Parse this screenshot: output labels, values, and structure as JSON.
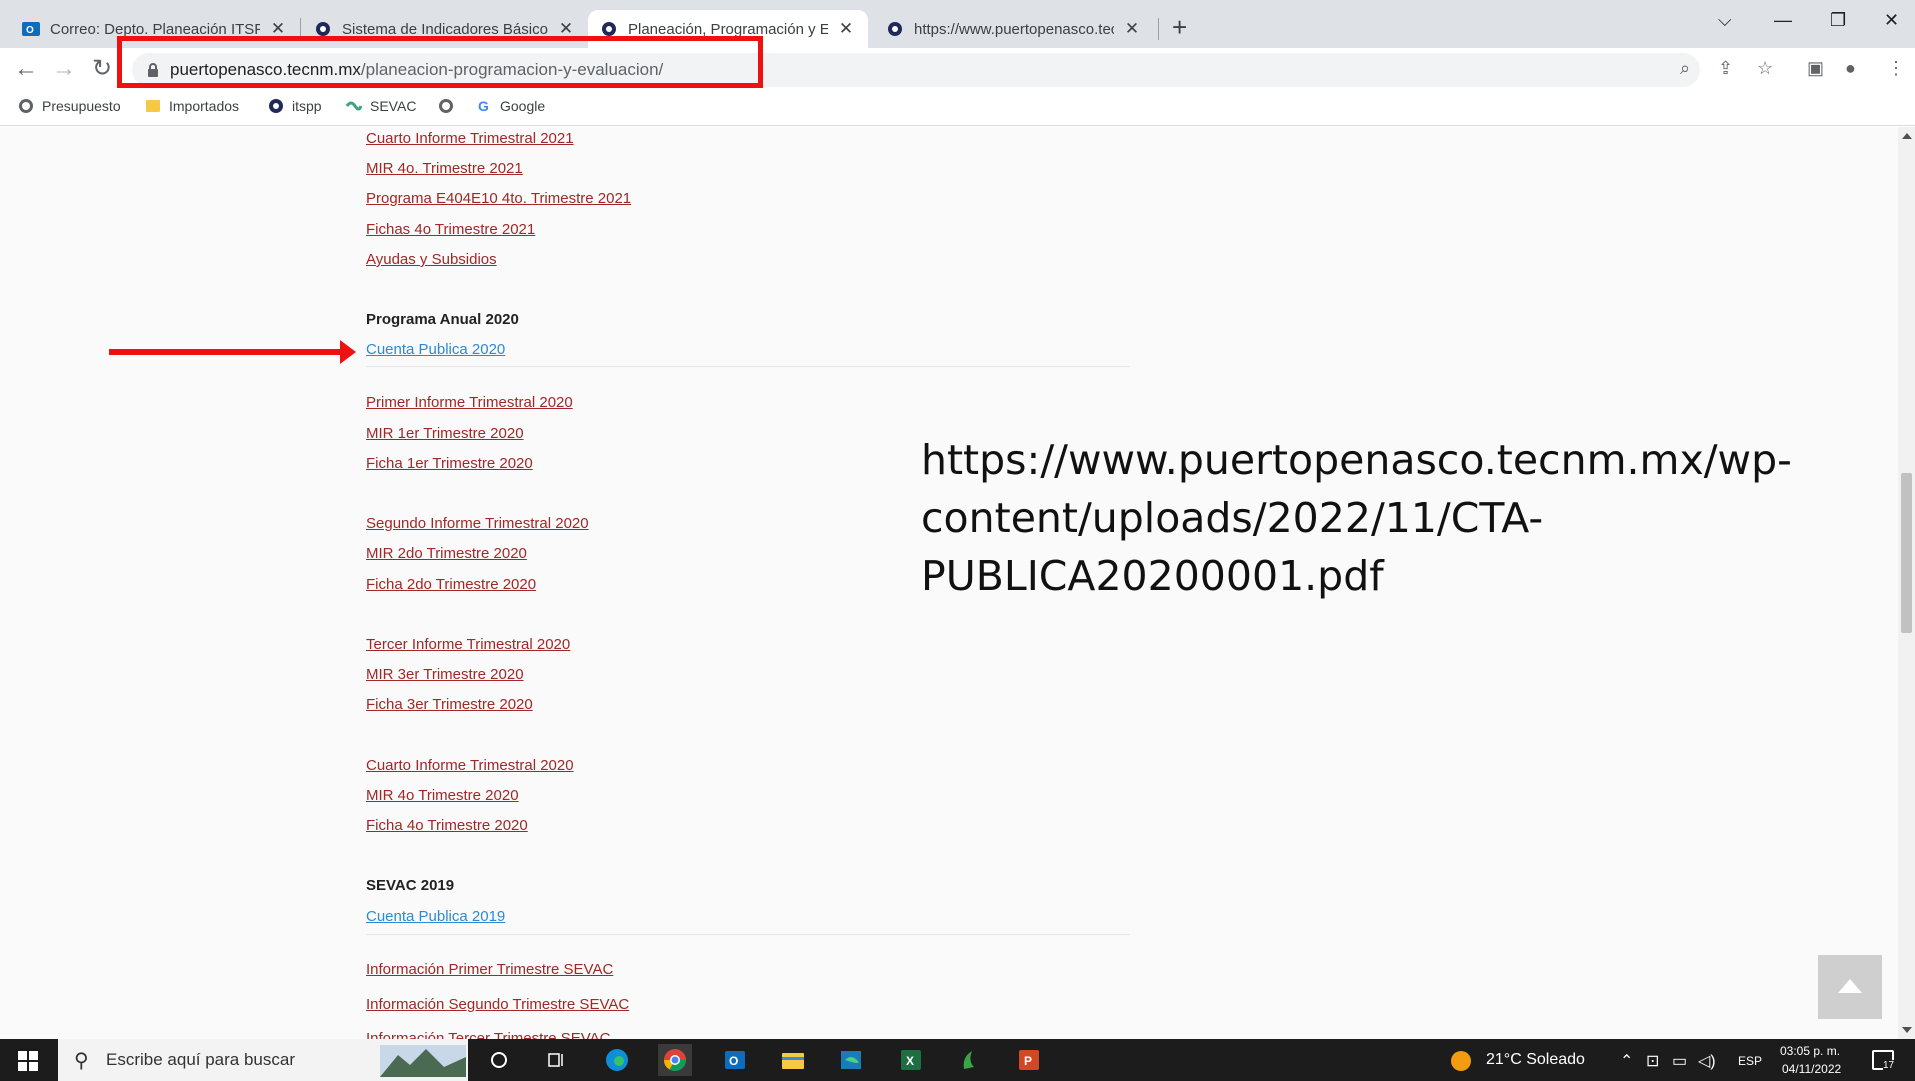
{
  "browser": {
    "tabs": [
      {
        "title": "Correo: Depto. Planeación ITSPP",
        "active": false
      },
      {
        "title": "Sistema de Indicadores Básicos",
        "active": false
      },
      {
        "title": "Planeación, Programación y Evalu",
        "active": true
      },
      {
        "title": "https://www.puertopenasco.tecnm",
        "active": false
      }
    ],
    "url_host": "puertopenasco.tecnm.mx",
    "url_path": "/planeacion-programacion-y-evaluacion/",
    "bookmarks": [
      "Presupuesto",
      "Importados",
      "itspp",
      "SEVAC",
      "Google"
    ]
  },
  "page": {
    "links_2021": [
      "Cuarto Informe Trimestral 2021",
      "MIR 4o. Trimestre 2021",
      "Programa E404E10 4to. Trimestre 2021",
      "Fichas 4o Trimestre 2021",
      "Ayudas y Subsidios"
    ],
    "section_2020": "Programa Anual 2020",
    "cuenta_2020": "Cuenta Publica 2020",
    "group1_2020": [
      "Primer Informe Trimestral 2020",
      "MIR 1er Trimestre 2020",
      "Ficha 1er Trimestre 2020"
    ],
    "group2_2020": [
      "Segundo Informe Trimestral 2020",
      "MIR 2do Trimestre 2020",
      "Ficha 2do Trimestre 2020"
    ],
    "group3_2020": [
      "Tercer Informe Trimestral 2020",
      "MIR 3er Trimestre 2020",
      "Ficha 3er Trimestre 2020"
    ],
    "group4_2020": [
      "Cuarto Informe Trimestral 2020",
      "MIR 4o Trimestre 2020",
      "Ficha 4o Trimestre 2020"
    ],
    "section_2019": "SEVAC 2019",
    "cuenta_2019": "Cuenta Publica 2019",
    "sevac_links": [
      "Información Primer Trimestre SEVAC",
      "Información Segundo Trimestre SEVAC",
      "Información Tercer Trimestre SEVAC"
    ],
    "annotation_url_lines": [
      "https://www.puertopenasco.tecnm.mx/wp-",
      "content/uploads/2022/11/CTA-",
      "PUBLICA20200001.pdf"
    ]
  },
  "taskbar": {
    "search_placeholder": "Escribe aquí para buscar",
    "weather": "21°C  Soleado",
    "language": "ESP",
    "time": "03:05 p. m.",
    "date": "04/11/2022",
    "notifications": "17"
  },
  "colors": {
    "link_red": "#a02828",
    "link_blue": "#2b8ad6",
    "annotation_red": "#ee1111"
  }
}
